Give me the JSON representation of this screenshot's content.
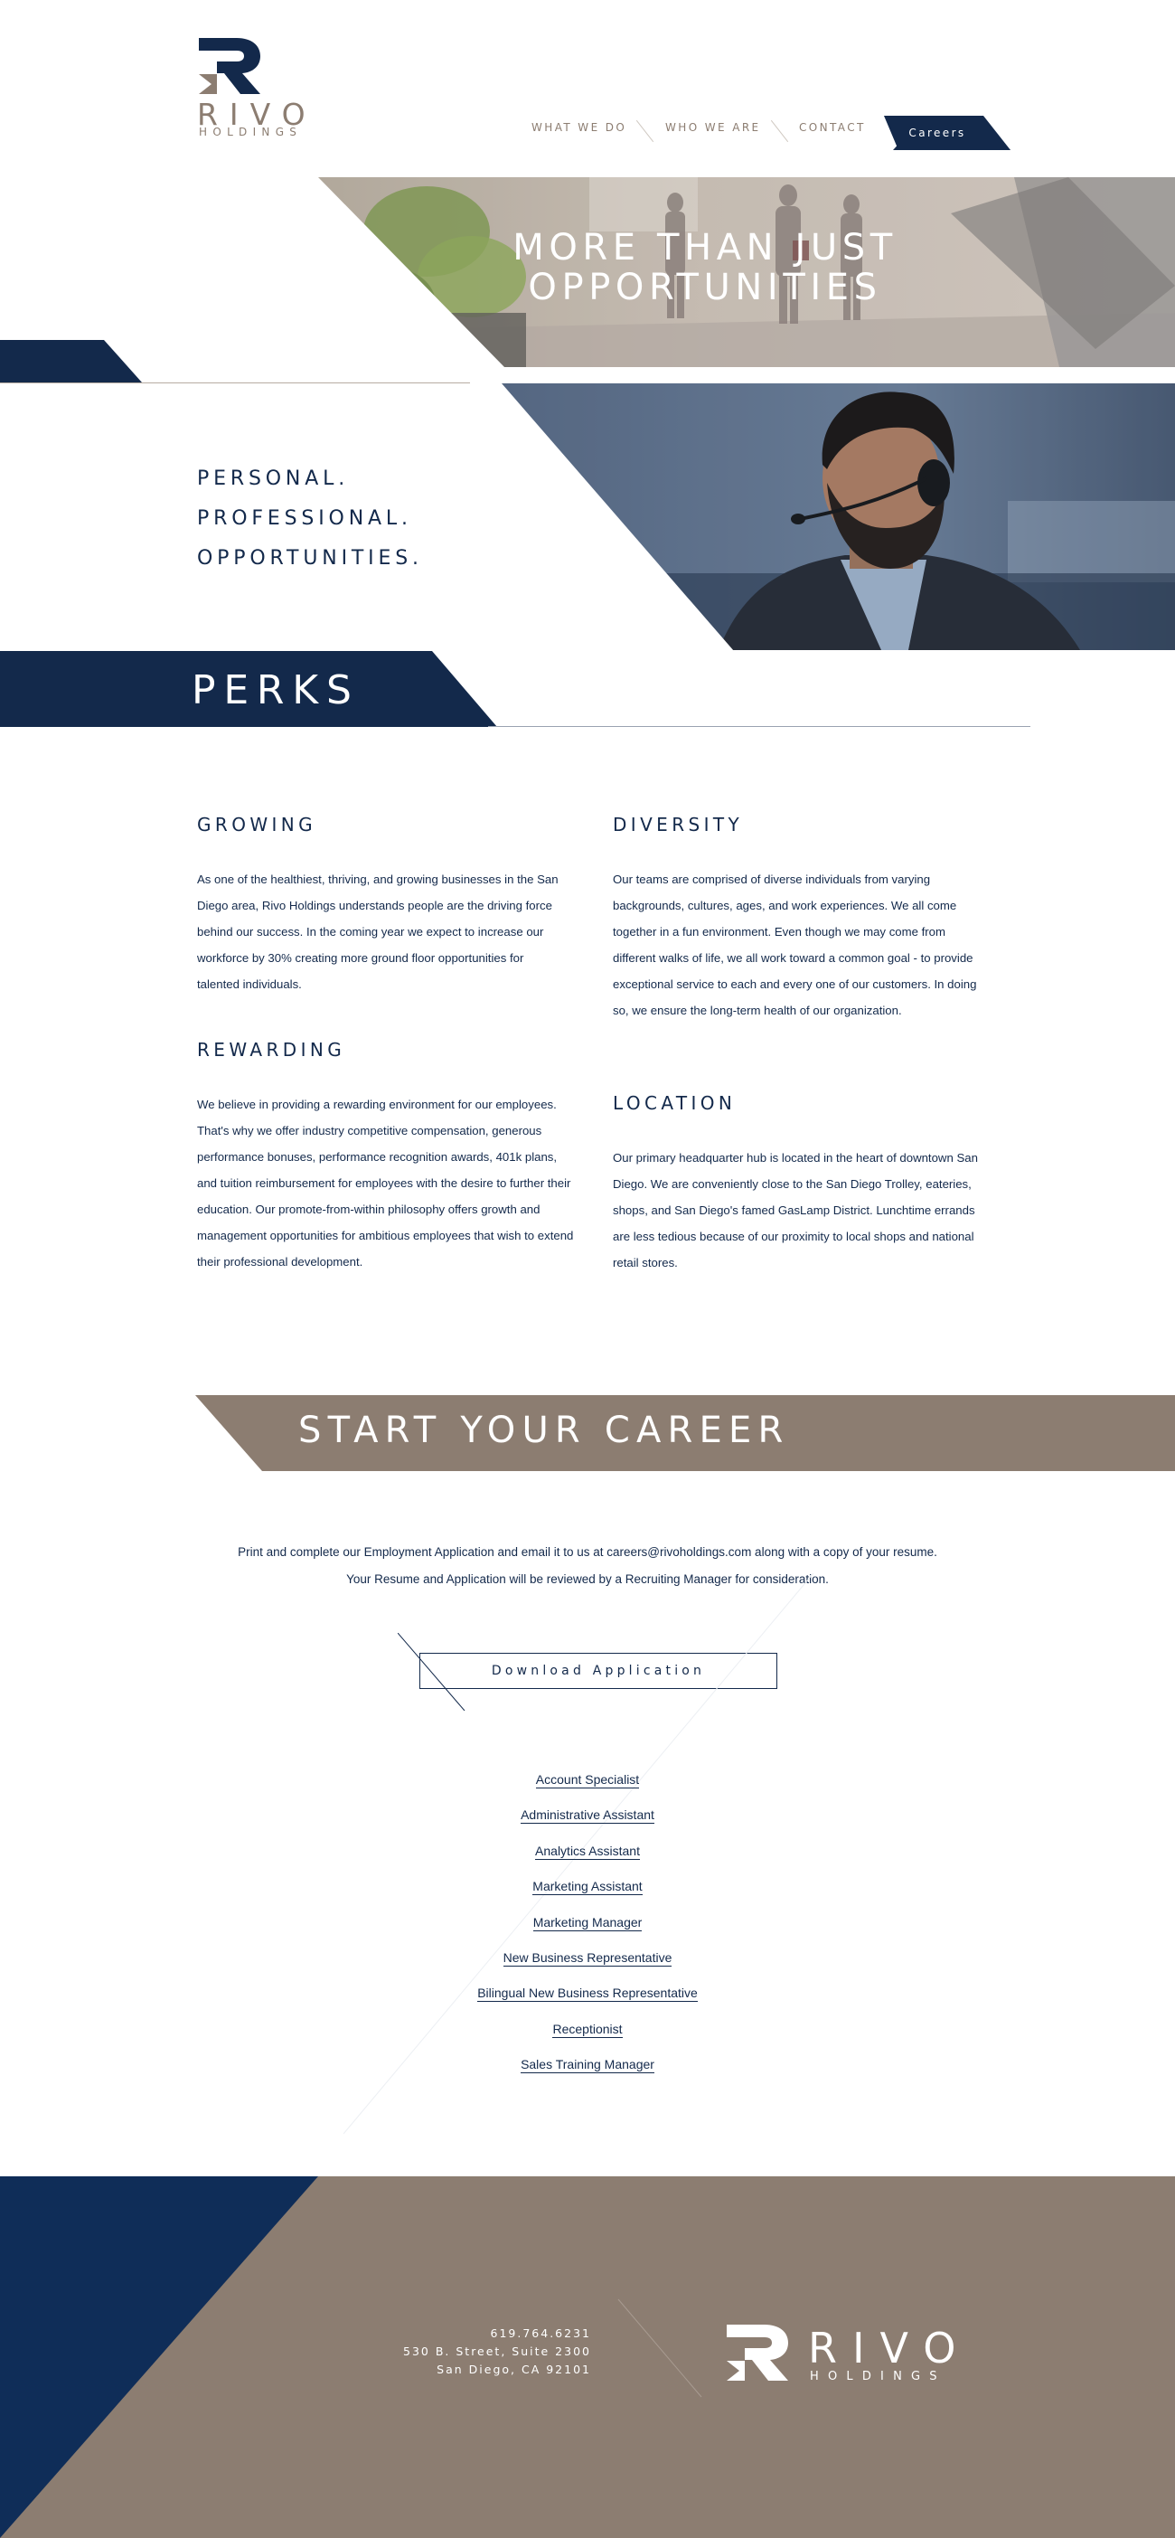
{
  "colors": {
    "navy": "#13294b",
    "taupe": "#8c7d71",
    "white": "#ffffff"
  },
  "logo": {
    "name": "RIVO",
    "sub": "HOLDINGS"
  },
  "nav": {
    "what_we_do": "What We Do",
    "who_we_are": "Who We Are",
    "contact": "Contact",
    "careers": "Careers"
  },
  "hero": {
    "title_line1": "More Than Just",
    "title_line2": "Opportunities"
  },
  "taglines": [
    "Personal.",
    "Professional.",
    "Opportunities."
  ],
  "perks": {
    "title": "Perks",
    "growing": {
      "heading": "Growing",
      "body": "As one of the healthiest, thriving, and growing businesses in the San Diego area, Rivo Holdings understands people are the driving force behind our success. In the coming year we expect to increase our workforce by 30% creating more ground floor opportunities for talented individuals."
    },
    "rewarding": {
      "heading": "Rewarding",
      "body": "We believe in providing a rewarding environment for our employees.  That's why we offer industry competitive compensation, generous performance bonuses, performance recognition awards, 401k plans, and tuition reimbursement for employees with the desire to further their education.  Our promote-from-within philosophy offers growth and management opportunities for ambitious employees that wish to extend their professional development."
    },
    "diversity": {
      "heading": "Diversity",
      "body": "Our teams are comprised of diverse individuals from varying backgrounds, cultures, ages, and work experiences.  We all come together in a fun environment. Even though we may come from different walks of life, we all work toward a common goal - to provide exceptional service to each and every one of our customers.  In doing so, we ensure the long-term health of our organization."
    },
    "location": {
      "heading": "Location",
      "body": "Our primary headquarter hub is located in the heart of downtown San Diego. We are conveniently close to the San Diego Trolley, eateries, shops, and San Diego's famed GasLamp District.  Lunchtime errands are less tedious because of our proximity to local shops and national retail stores."
    }
  },
  "career": {
    "title": "Start Your Career",
    "text": "Print and complete our Employment Application and email it to us at careers@rivoholdings.com along with a copy of your resume. Your Resume and Application will be reviewed by a Recruiting Manager for consideration.",
    "download_label": "Download Application"
  },
  "jobs": [
    "Account Specialist",
    "Administrative Assistant",
    "Analytics Assistant",
    "Marketing Assistant",
    "Marketing Manager",
    "New Business Representative",
    "Bilingual New Business Representative",
    "Receptionist",
    "Sales Training Manager"
  ],
  "footer": {
    "phone": "619.764.6231",
    "street": "530 B. Street, Suite 2300",
    "city": "San Diego, CA 92101"
  }
}
